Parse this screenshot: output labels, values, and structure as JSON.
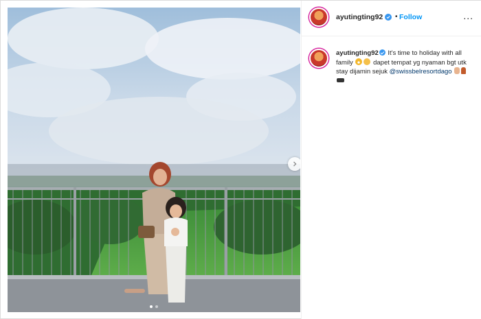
{
  "post": {
    "username": "ayutingting92",
    "follow_label": "Follow",
    "separator": "•",
    "more_label": "...",
    "caption": {
      "part1": "It's time to holiday with all family",
      "part2": "dapet tempat yg nyaman bgt utk stay dijamin sejuk",
      "mention": "@swissbelresortdago"
    },
    "carousel": {
      "current_slide": 1,
      "total_slides": 2
    }
  },
  "colors": {
    "follow_blue": "#0095f6",
    "verified_blue": "#3897f0",
    "mention": "#00376b"
  },
  "icons": {
    "verified": "verified-badge-icon",
    "next": "chevron-right-icon",
    "more": "more-options-icon"
  }
}
